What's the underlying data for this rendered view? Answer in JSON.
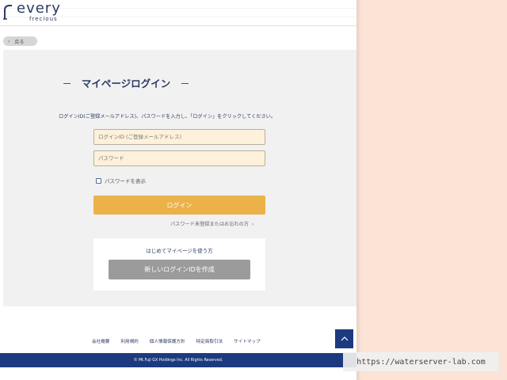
{
  "header": {
    "brand": "every",
    "brand_sub": "frecious"
  },
  "nav": {
    "back_label": "戻る"
  },
  "main": {
    "title": "マイページログイン",
    "title_dash": "－",
    "instruction": "ログインID(ご登録メールアドレス)、パスワードを入力し、「ログイン」をクリックしてください。",
    "login_id_placeholder": "ログインID (ご登録メールアドレス)",
    "password_placeholder": "パスワード",
    "show_password_label": "パスワードを表示",
    "login_button": "ログイン",
    "forgot_link": "パスワード未登録またはお忘れの方",
    "new_user": {
      "title": "はじめてマイページを使う方",
      "create_button": "新しいログインIDを作成"
    }
  },
  "footer": {
    "links": [
      "会社概要",
      "利用規約",
      "個人情報保護方針",
      "特定商取引法",
      "サイトマップ"
    ],
    "copyright": "© Mt.Fuji GX Holdings Inc. All Rights Reserved."
  },
  "watermark": {
    "text": "https://waterserver-lab.com"
  },
  "colors": {
    "navy": "#2b3a63",
    "footer_navy": "#1d3a7e",
    "login_orange": "#ebb24a",
    "field_fill": "#fdf1db",
    "panel_gray": "#f1f1f1",
    "right_bg": "#fbe3d6"
  }
}
